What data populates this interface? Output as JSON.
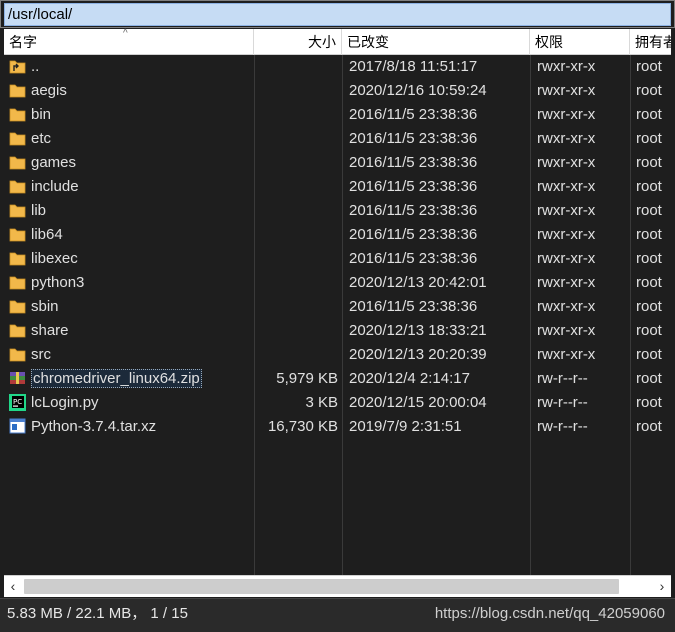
{
  "path": "/usr/local/",
  "columns": {
    "name": "名字",
    "size": "大小",
    "modified": "已改变",
    "permissions": "权限",
    "owner": "拥有者"
  },
  "files": [
    {
      "name": "..",
      "size": "",
      "modified": "2017/8/18 11:51:17",
      "permissions": "rwxr-xr-x",
      "owner": "root",
      "icon": "parent-folder-icon"
    },
    {
      "name": "aegis",
      "size": "",
      "modified": "2020/12/16 10:59:24",
      "permissions": "rwxr-xr-x",
      "owner": "root",
      "icon": "folder-icon"
    },
    {
      "name": "bin",
      "size": "",
      "modified": "2016/11/5 23:38:36",
      "permissions": "rwxr-xr-x",
      "owner": "root",
      "icon": "folder-icon"
    },
    {
      "name": "etc",
      "size": "",
      "modified": "2016/11/5 23:38:36",
      "permissions": "rwxr-xr-x",
      "owner": "root",
      "icon": "folder-icon"
    },
    {
      "name": "games",
      "size": "",
      "modified": "2016/11/5 23:38:36",
      "permissions": "rwxr-xr-x",
      "owner": "root",
      "icon": "folder-icon"
    },
    {
      "name": "include",
      "size": "",
      "modified": "2016/11/5 23:38:36",
      "permissions": "rwxr-xr-x",
      "owner": "root",
      "icon": "folder-icon"
    },
    {
      "name": "lib",
      "size": "",
      "modified": "2016/11/5 23:38:36",
      "permissions": "rwxr-xr-x",
      "owner": "root",
      "icon": "folder-icon"
    },
    {
      "name": "lib64",
      "size": "",
      "modified": "2016/11/5 23:38:36",
      "permissions": "rwxr-xr-x",
      "owner": "root",
      "icon": "folder-icon"
    },
    {
      "name": "libexec",
      "size": "",
      "modified": "2016/11/5 23:38:36",
      "permissions": "rwxr-xr-x",
      "owner": "root",
      "icon": "folder-icon"
    },
    {
      "name": "python3",
      "size": "",
      "modified": "2020/12/13 20:42:01",
      "permissions": "rwxr-xr-x",
      "owner": "root",
      "icon": "folder-icon"
    },
    {
      "name": "sbin",
      "size": "",
      "modified": "2016/11/5 23:38:36",
      "permissions": "rwxr-xr-x",
      "owner": "root",
      "icon": "folder-icon"
    },
    {
      "name": "share",
      "size": "",
      "modified": "2020/12/13 18:33:21",
      "permissions": "rwxr-xr-x",
      "owner": "root",
      "icon": "folder-icon"
    },
    {
      "name": "src",
      "size": "",
      "modified": "2020/12/13 20:20:39",
      "permissions": "rwxr-xr-x",
      "owner": "root",
      "icon": "folder-icon"
    },
    {
      "name": "chromedriver_linux64.zip",
      "size": "5,979 KB",
      "modified": "2020/12/4 2:14:17",
      "permissions": "rw-r--r--",
      "owner": "root",
      "icon": "zip-archive-icon",
      "selected": true
    },
    {
      "name": "lcLogin.py",
      "size": "3 KB",
      "modified": "2020/12/15 20:00:04",
      "permissions": "rw-r--r--",
      "owner": "root",
      "icon": "pycharm-file-icon"
    },
    {
      "name": "Python-3.7.4.tar.xz",
      "size": "16,730 KB",
      "modified": "2019/7/9 2:31:51",
      "permissions": "rw-r--r--",
      "owner": "root",
      "icon": "archive-file-icon"
    }
  ],
  "status": {
    "summary": "5.83 MB / 22.1 MB，  1 / 15",
    "watermark": "https://blog.csdn.net/qq_42059060"
  },
  "colors": {
    "folder": "#f2b84a",
    "selection_path": "#c6dcf4",
    "background": "#1e1e1e"
  }
}
